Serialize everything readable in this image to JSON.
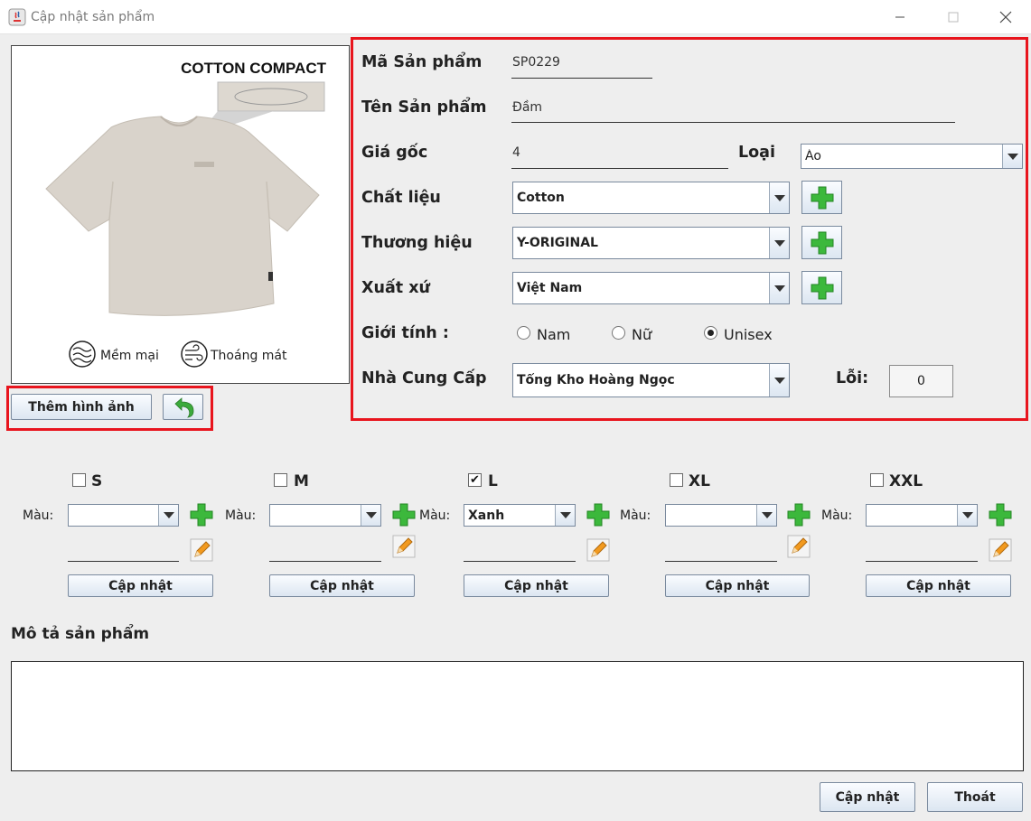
{
  "window": {
    "title": "Cập nhật sản phẩm"
  },
  "image_panel": {
    "brand_text": "COTTON COMPACT",
    "feature_1": "Mềm mại",
    "feature_2": "Thoáng mát"
  },
  "image_actions": {
    "add_image_label": "Thêm hình ảnh"
  },
  "form": {
    "code_label": "Mã Sản phẩm",
    "code_value": "SP0229",
    "name_label": "Tên Sản phẩm",
    "name_value": "Đầm",
    "price_label": "Giá gốc",
    "price_value": "4",
    "type_label": "Loại",
    "type_value": "Áo",
    "material_label": "Chất liệu",
    "material_value": "Cotton",
    "brand_label": "Thương hiệu",
    "brand_value": "Y-ORIGINAL",
    "origin_label": "Xuất xứ",
    "origin_value": "Việt Nam",
    "gender_label": "Giới tính :",
    "gender_options": [
      "Nam",
      "Nữ",
      "Unisex"
    ],
    "gender_selected": "Unisex",
    "supplier_label": "Nhà Cung Cấp",
    "supplier_value": "Tổng Kho Hoàng Ngọc",
    "defect_label": "Lỗi:",
    "defect_value": "0"
  },
  "sizes": [
    {
      "label": "S",
      "checked": false,
      "color_label": "Màu:",
      "color_value": "",
      "update_label": "Cập nhật"
    },
    {
      "label": "M",
      "checked": false,
      "color_label": "Màu:",
      "color_value": "",
      "update_label": "Cập nhật"
    },
    {
      "label": "L",
      "checked": true,
      "color_label": "Màu:",
      "color_value": "Xanh",
      "update_label": "Cập nhật"
    },
    {
      "label": "XL",
      "checked": false,
      "color_label": "Màu:",
      "color_value": "",
      "update_label": "Cập nhật"
    },
    {
      "label": "XXL",
      "checked": false,
      "color_label": "Màu:",
      "color_value": "",
      "update_label": "Cập nhật"
    }
  ],
  "description": {
    "title": "Mô tả sản phẩm",
    "value": ""
  },
  "footer": {
    "update_label": "Cập nhật",
    "exit_label": "Thoát"
  },
  "colors": {
    "highlight": "#e8141d",
    "plus_green": "#3cb83c",
    "pencil_orange": "#f29a1f",
    "back_arrow": "#3caa3c"
  }
}
